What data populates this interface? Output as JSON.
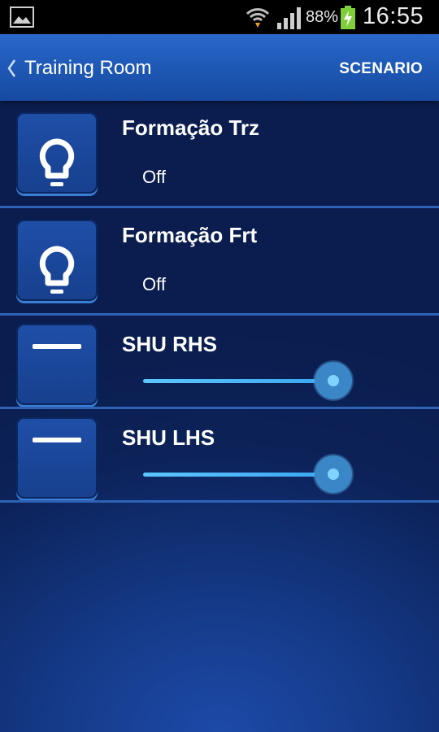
{
  "status_bar": {
    "battery_percent": "88%",
    "time": "16:55",
    "icons": [
      "gallery-icon",
      "wifi-icon",
      "signal-icon",
      "battery-charging-icon"
    ]
  },
  "header": {
    "title": "Training Room",
    "action_label": "SCENARIO",
    "back_icon": "chevron-left-icon"
  },
  "devices": [
    {
      "name": "Formação Trz",
      "type": "light",
      "icon": "lightbulb-icon",
      "status": "Off"
    },
    {
      "name": "Formação Frt",
      "type": "light",
      "icon": "lightbulb-icon",
      "status": "Off"
    },
    {
      "name": "SHU RHS",
      "type": "shutter",
      "icon": "shutter-icon",
      "level_percent": 90
    },
    {
      "name": "SHU LHS",
      "type": "shutter",
      "icon": "shutter-icon",
      "level_percent": 90
    }
  ],
  "colors": {
    "header_blue": "#1f5ab8",
    "background_dark": "#0a1d4e",
    "divider": "#2f62b6",
    "slider_accent": "#5cc6ff"
  }
}
